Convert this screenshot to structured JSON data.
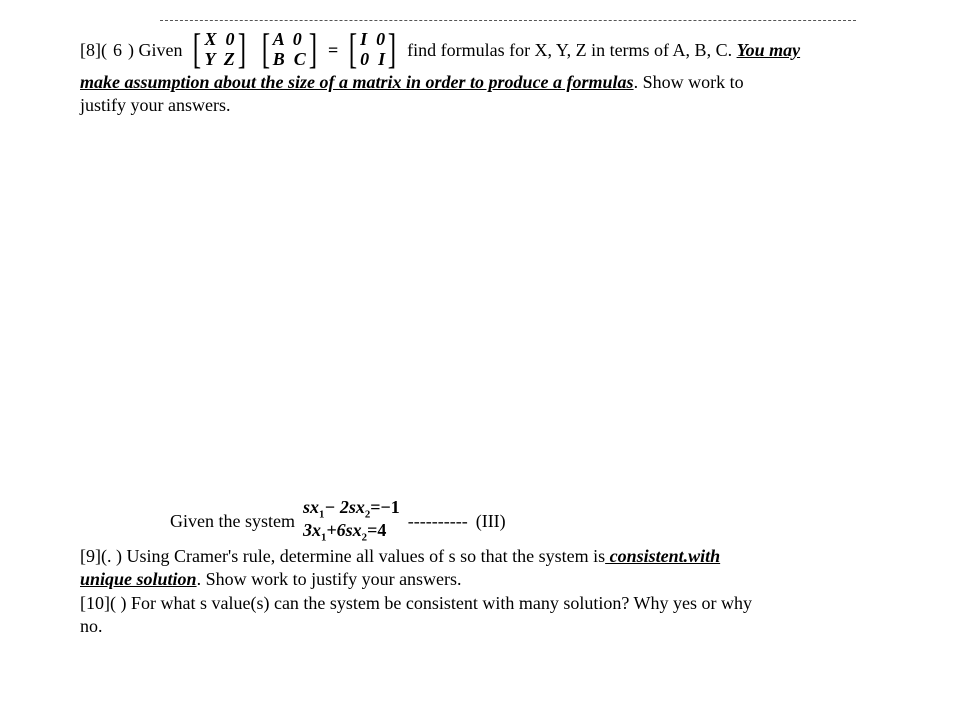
{
  "q8": {
    "prefix": "[8](   ",
    "letter": "6",
    "paren": ") Given",
    "m1r1": "X  0",
    "m1r2": "Y  Z",
    "m2r1": "A  0",
    "m2r2": "B  C",
    "eq": "=",
    "m3r1": "I  0",
    "m3r2": "0  I",
    "tail": "find formulas for X, Y, Z in terms of A, B, C. ",
    "youmay": "You may",
    "line2a": "make assumption about the size of a matrix in order to produce a formulas",
    "line2b": ". Show work to",
    "line3": "justify your answers."
  },
  "mid": {
    "given": "Given the system",
    "eq1_left": "sx",
    "eq1_s1": "1",
    "eq1_mid": "− 2sx",
    "eq1_s2": "2",
    "eq1_rhs": "=−1",
    "eq2_left": "3x",
    "eq2_s1": "1",
    "eq2_mid": "+6sx",
    "eq2_s2": "2",
    "eq2_rhs": "=4",
    "dashes": "----------",
    "label": "(III)"
  },
  "q9": {
    "line1a": "[9](.   ",
    "line1b": ") Using Cramer's rule, determine all values of s so that the system is",
    "cw": " consistent.with",
    "line2a": "unique solution",
    "line2b": ". Show work to justify your answers."
  },
  "q10": {
    "line1": "[10](    ) For what s value(s) can the system be consistent with many solution? Why yes or why",
    "line2": "no."
  }
}
